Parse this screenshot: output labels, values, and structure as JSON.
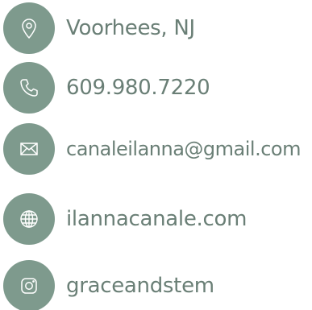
{
  "accent_color": "#7e9a8d",
  "text_color": "#6a7f76",
  "contacts": [
    {
      "icon": "location-pin-icon",
      "text": "Voorhees, NJ"
    },
    {
      "icon": "phone-icon",
      "text": "609.980.7220"
    },
    {
      "icon": "envelope-icon",
      "text": "canaleilanna@gmail.com"
    },
    {
      "icon": "globe-icon",
      "text": "ilannacanale.com"
    },
    {
      "icon": "instagram-icon",
      "text": "graceandstem"
    }
  ]
}
